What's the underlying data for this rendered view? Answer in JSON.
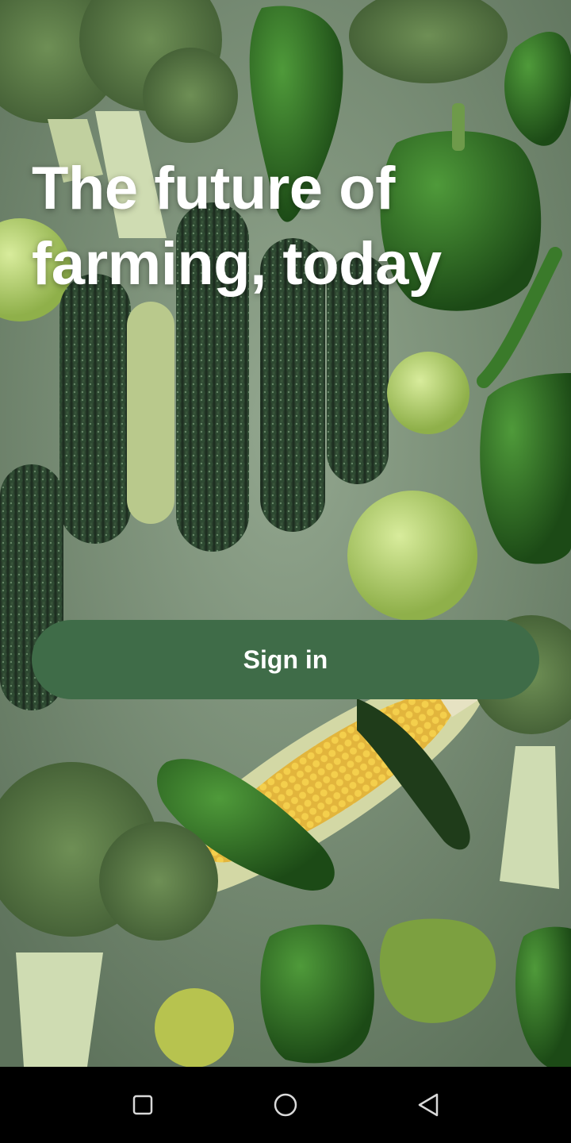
{
  "hero": {
    "headline": "The future of farming, today"
  },
  "actions": {
    "sign_in_label": "Sign in"
  },
  "background": {
    "description_icon": "vegetables-background-image"
  },
  "navbar": {
    "recent_icon": "square-icon",
    "home_icon": "circle-icon",
    "back_icon": "triangle-back-icon"
  },
  "colors": {
    "button": "#3f6c48",
    "button_text": "#ffffff",
    "headline": "#ffffff",
    "navbar": "#000000"
  }
}
